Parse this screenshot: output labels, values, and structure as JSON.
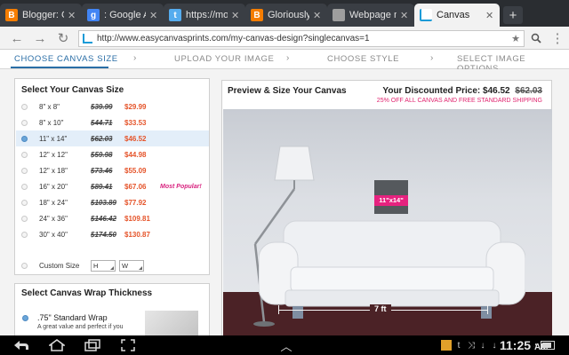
{
  "browser": {
    "tabs": [
      {
        "title": "Blogger: Glo",
        "icon": "blogger-icon",
        "color": "#f57d00"
      },
      {
        "title": ": Google Ad",
        "icon": "google-icon",
        "color": "#4285f4"
      },
      {
        "title": "https://mobi",
        "icon": "twitter-icon",
        "color": "#55acee"
      },
      {
        "title": "Gloriously M",
        "icon": "blogger-icon",
        "color": "#f57d00"
      },
      {
        "title": "Webpage no",
        "icon": "document-icon",
        "color": "#9e9e9e"
      },
      {
        "title": "Canvas",
        "icon": "easycanvas-icon",
        "color": "#1a9bd7"
      }
    ],
    "url": "http://www.easycanvasprints.com/my-canvas-design?singlecanvas=1"
  },
  "steps": [
    {
      "label": "Choose Canvas Size"
    },
    {
      "label": "Upload Your Image"
    },
    {
      "label": "Choose Style"
    },
    {
      "label": "Select Image Options"
    }
  ],
  "size_panel": {
    "title": "Select Your Canvas Size",
    "options": [
      {
        "size": "8\" x 8\"",
        "old": "$39.99",
        "new": "$29.99",
        "note": ""
      },
      {
        "size": "8\" x 10\"",
        "old": "$44.71",
        "new": "$33.53",
        "note": ""
      },
      {
        "size": "11\" x 14\"",
        "old": "$62.03",
        "new": "$46.52",
        "note": ""
      },
      {
        "size": "12\" x 12\"",
        "old": "$59.98",
        "new": "$44.98",
        "note": ""
      },
      {
        "size": "12\" x 18\"",
        "old": "$73.46",
        "new": "$55.09",
        "note": ""
      },
      {
        "size": "16\" x 20\"",
        "old": "$89.41",
        "new": "$67.06",
        "note": "Most Popular!"
      },
      {
        "size": "18\" x 24\"",
        "old": "$103.89",
        "new": "$77.92",
        "note": ""
      },
      {
        "size": "24\" x 36\"",
        "old": "$146.42",
        "new": "$109.81",
        "note": ""
      },
      {
        "size": "30\" x 40\"",
        "old": "$174.50",
        "new": "$130.87",
        "note": ""
      }
    ],
    "selected_index": 2,
    "custom_label": "Custom Size",
    "custom_h": "H",
    "custom_w": "W"
  },
  "wrap_panel": {
    "title": "Select Canvas Wrap Thickness",
    "option": ".75\" Standard Wrap",
    "desc": "A great value and perfect if you"
  },
  "preview": {
    "title": "Preview & Size Your Canvas",
    "price_label": "Your Discounted Price:",
    "price_new": "$46.52",
    "price_old": "$62.03",
    "promo": "25% OFF ALL CANVAS AND FREE STANDARD SHIPPING",
    "canvas_tag": "11\"x14\"",
    "measure": "7 ft"
  },
  "system": {
    "time": "11:25",
    "ampm": "AM",
    "battery_level": 0.8
  }
}
